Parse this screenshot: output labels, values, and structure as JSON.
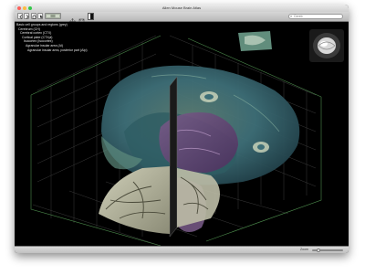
{
  "window": {
    "title": "Allen Mouse Brain Atlas"
  },
  "search": {
    "placeholder": "Cereb"
  },
  "tree": [
    "Basic cell groups and regions (grey)",
    "Cerebrum (CH)",
    "Cerebral cortex (CTX)",
    "Cortical plate (CTXpl)",
    "Isocortex (Isocortex)",
    "Agranular insular area (AI)",
    "Agranular insular area, posterior part (AIp)"
  ],
  "statusbar": {
    "zoom_label": "Zoom",
    "zoom_level": 0.15
  },
  "colors": {
    "accent": "#2f6fd6",
    "tree_text": "#e8e8e8"
  }
}
